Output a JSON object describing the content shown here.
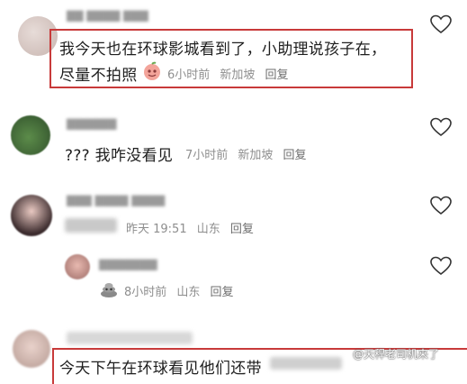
{
  "comments": [
    {
      "username": "▇▇ ▇▇▇▇ ▇▇▇",
      "text_line1": "我今天也在环球影城看到了，小助理说孩子在，",
      "text_line2": "尽量不拍照",
      "time": "6小时前",
      "location": "新加坡",
      "reply": "回复",
      "emoji": "peach-emoji"
    },
    {
      "username": "▇▇▇▇▇▇",
      "text": "??? 我咋没看见",
      "time": "7小时前",
      "location": "新加坡",
      "reply": "回复"
    },
    {
      "username": "▇▇▇ ▇▇▇▇ ▇▇▇▇",
      "time": "昨天 19:51",
      "location": "山东",
      "reply": "回复",
      "replies": [
        {
          "username": "▇▇▇▇▇▇▇",
          "time": "8小时前",
          "location": "山东",
          "reply": "回复",
          "emoji": "poop-emoji"
        }
      ]
    },
    {
      "text_partial": "今天下午在环球看见他们还带"
    }
  ],
  "watermark": "@天稈老司机来了",
  "colors": {
    "highlight_box": "#c83a3a",
    "meta_text": "#8e8e8e",
    "body_text": "#1e1e1e"
  }
}
